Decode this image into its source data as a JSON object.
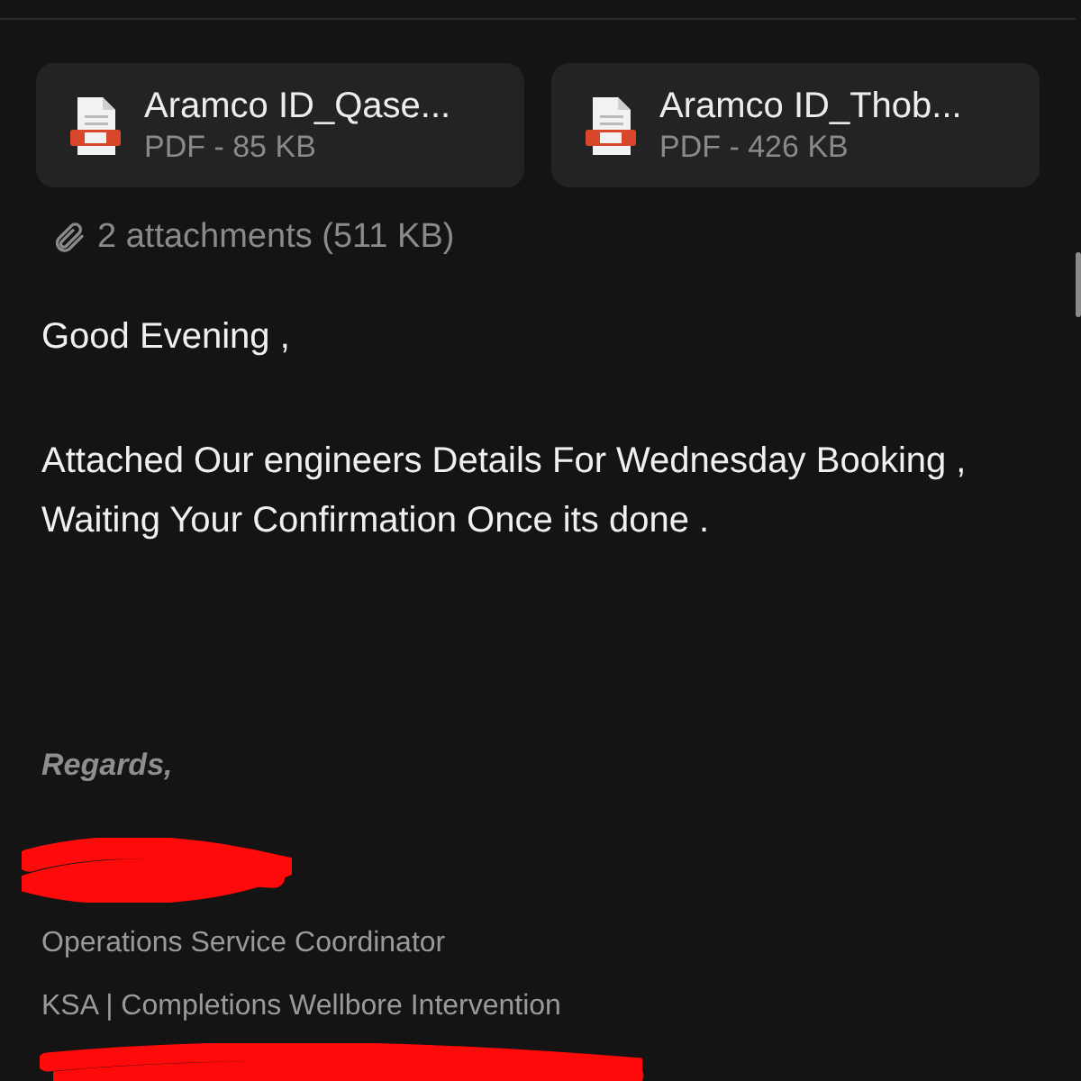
{
  "attachments": [
    {
      "name": "Aramco ID_Qase...",
      "meta": "PDF - 85 KB"
    },
    {
      "name": "Aramco ID_Thob...",
      "meta": "PDF - 426 KB"
    }
  ],
  "attachments_summary": "2 attachments (511 KB)",
  "body": {
    "greeting": "Good Evening ,",
    "paragraph": "Attached Our engineers Details For Wednesday Booking , Waiting Your Confirmation Once its done ."
  },
  "signature": {
    "closing": "Regards,",
    "lines": [
      "Operations Service Coordinator",
      "KSA | Completions Wellbore Intervention"
    ]
  }
}
